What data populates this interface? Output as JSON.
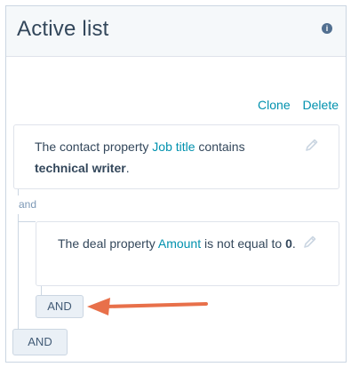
{
  "header": {
    "title": "Active list",
    "info_icon": "info-icon"
  },
  "actions": {
    "clone": "Clone",
    "delete": "Delete"
  },
  "filter1": {
    "prefix": "The contact property ",
    "property": "Job title",
    "operator": " contains ",
    "value": "technical writer",
    "suffix": "."
  },
  "group_connector": "and",
  "filter2": {
    "prefix": "The deal property ",
    "property": "Amount",
    "operator": " is not equal to ",
    "value": "0",
    "suffix": "."
  },
  "buttons": {
    "inner_and": "AND",
    "outer_and": "AND"
  },
  "colors": {
    "link": "#0091ae",
    "arrow": "#e8704a",
    "text": "#33475b"
  }
}
